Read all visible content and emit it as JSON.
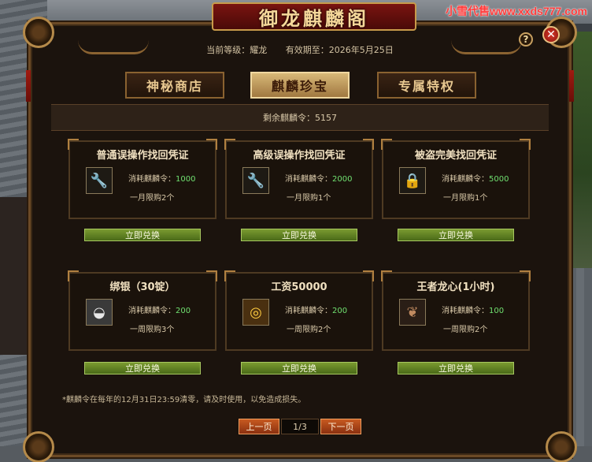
{
  "watermark": "小雪代售www.xxds777.com",
  "window": {
    "title": "御龙麒麟阁",
    "help_label": "?",
    "close_label": "✕"
  },
  "header": {
    "level_text": "当前等级：耀龙",
    "expiry_text": "有效期至：2026年5月25日"
  },
  "tabs": [
    {
      "label": "神秘商店",
      "active": false
    },
    {
      "label": "麒麟珍宝",
      "active": true
    },
    {
      "label": "专属特权",
      "active": false
    }
  ],
  "remaining_text": "剩余麒麟令：5157",
  "cost_prefix": "消耗麒麟令：",
  "items": [
    {
      "title": "普通误操作找回凭证",
      "cost": "1000",
      "limit": "一月限购2个",
      "icon": "wrench-icon",
      "redeem": "立即兑换"
    },
    {
      "title": "高级误操作找回凭证",
      "cost": "2000",
      "limit": "一月限购1个",
      "icon": "wrench-icon",
      "redeem": "立即兑换"
    },
    {
      "title": "被盗完美找回凭证",
      "cost": "5000",
      "limit": "一月限购1个",
      "icon": "lock-icon",
      "redeem": "立即兑换"
    },
    {
      "title": "绑银（30锭）",
      "cost": "200",
      "limit": "一周限购3个",
      "icon": "silver-ingot-icon",
      "redeem": "立即兑换"
    },
    {
      "title": "工资50000",
      "cost": "200",
      "limit": "一周限购2个",
      "icon": "gold-coins-icon",
      "redeem": "立即兑换"
    },
    {
      "title": "王者龙心(1小时)",
      "cost": "100",
      "limit": "一周限购2个",
      "icon": "dragon-heart-icon",
      "redeem": "立即兑换"
    }
  ],
  "note": "*麒麟令在每年的12月31日23:59清零，请及时使用，以免造成损失。",
  "pager": {
    "prev_label": "上一页",
    "page_text": "1/3",
    "next_label": "下一页"
  },
  "colors": {
    "accent_gold": "#e8c890",
    "redeem_green": "#6a8a28",
    "cost_green": "#70e070",
    "close_red": "#d8382a"
  }
}
